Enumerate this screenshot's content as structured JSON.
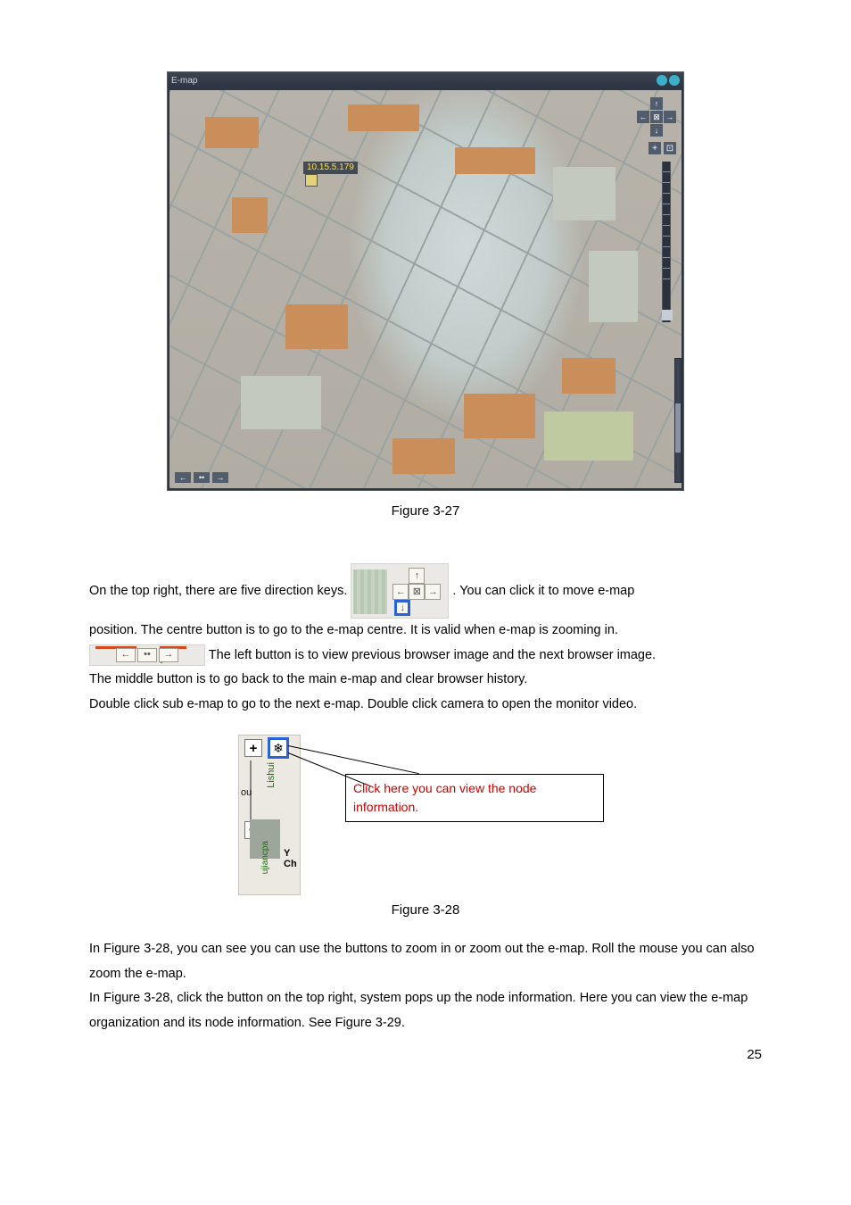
{
  "emap_window": {
    "title": "E-map",
    "ip_label": "10.15.5.179",
    "directions": {
      "up": "↑",
      "down": "↓",
      "left": "←",
      "right": "→",
      "center": "⊠"
    },
    "zoom_plus": "+",
    "zoom_minus": "⊡",
    "browser_prev": "←",
    "browser_home": "••",
    "browser_next": "→"
  },
  "captions": {
    "fig27": "Figure 3-27",
    "fig28": "Figure 3-28"
  },
  "paragraphs": {
    "p1a": "On the top right, there are five direction keys. ",
    "p1b": ". You can click it to move e-map",
    "p2": "position. The centre button is to go to the e-map centre. It is valid when e-map is zooming in.",
    "p3": " The left button is to view previous browser image and the next browser image.",
    "p4": "The middle button is to go back to the main e-map and clear browser history.",
    "p5": "Double click sub e-map to go to the next e-map. Double click camera to open the monitor video.",
    "p6": "In Figure 3-28, you can see you can use the buttons to zoom in or zoom out the e-map. Roll the mouse you can also zoom the e-map.",
    "p7": "In Figure 3-28, click the button on the top right, system pops up the node information. Here you can view the e-map organization and its node information. See Figure 3-29."
  },
  "inline_dir": {
    "up": "↑",
    "down": "↓",
    "left": "←",
    "right": "→",
    "center": "⊠"
  },
  "inline_nav": {
    "prev": "←",
    "home": "••",
    "next": "→"
  },
  "fig28": {
    "plus": "+",
    "flake": "❄",
    "minus": "−",
    "label1": "Lishui",
    "label2": "ujiancpa",
    "ou": "ou",
    "y": "Y",
    "ch": "Ch",
    "callout": "Click here you can view the node information."
  },
  "page_number": "25"
}
